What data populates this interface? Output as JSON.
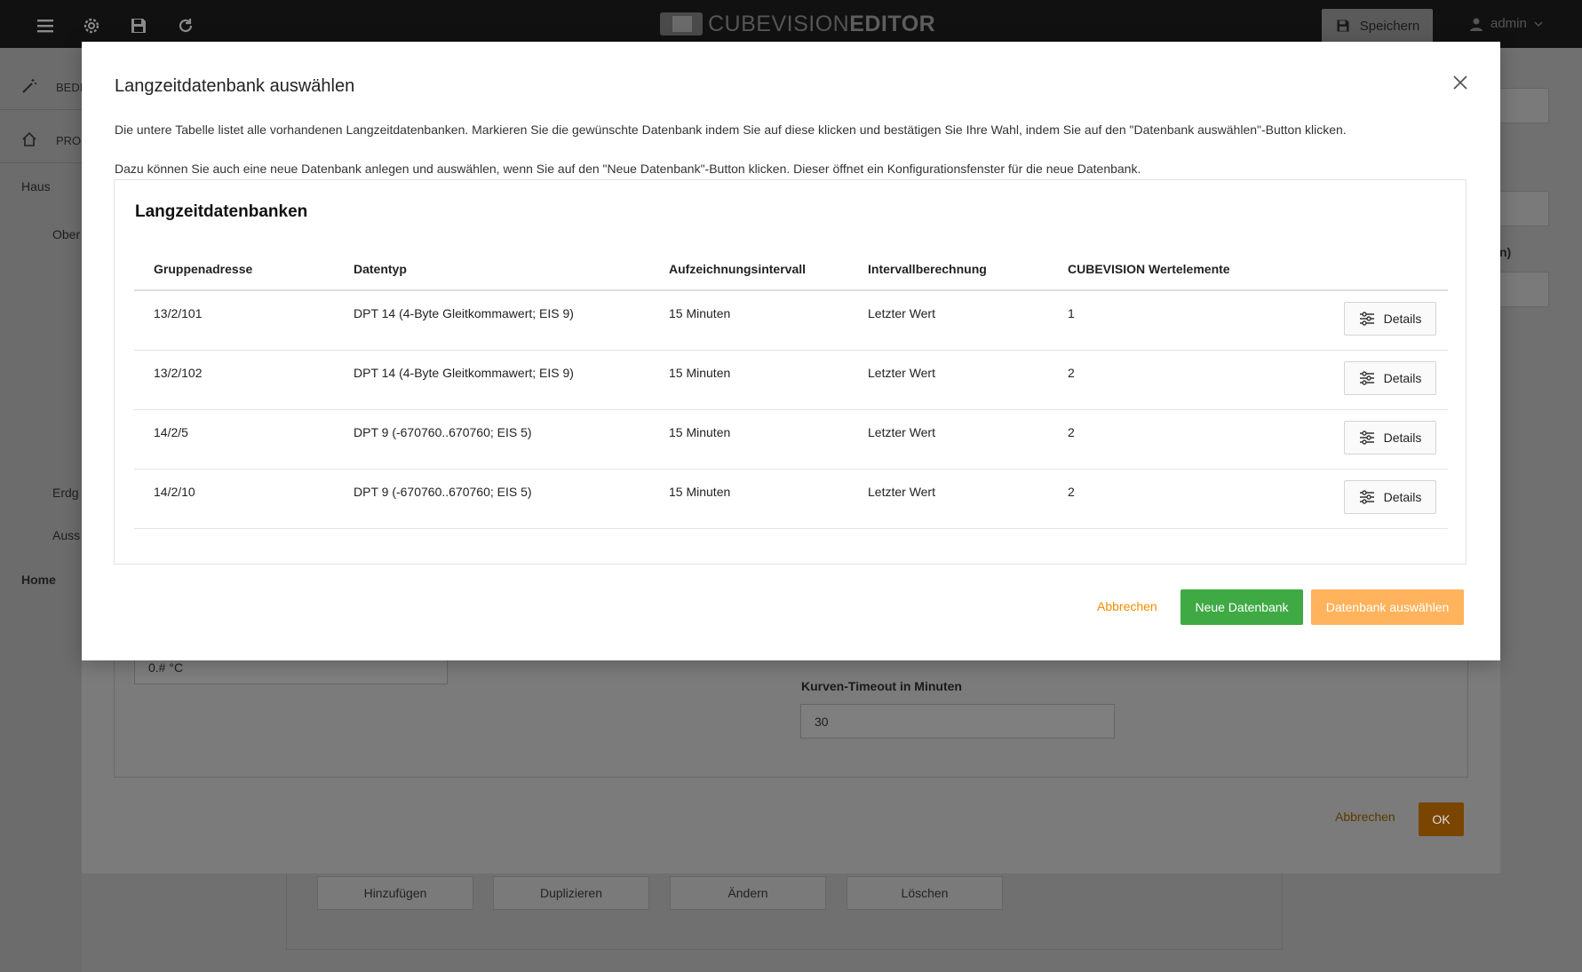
{
  "app": {
    "logo_light": "CUBEVISION",
    "logo_bold": "EDITOR",
    "save_label": "Speichern",
    "user_name": "admin"
  },
  "background": {
    "sidebar": [
      "BEDI",
      "PRO",
      "Haus",
      "Ober",
      "Erdg",
      "Auss",
      "Home"
    ],
    "right_fragment": "n)",
    "format_value": "0.# °C",
    "timeout_label": "Kurven-Timeout in Minuten",
    "timeout_value": "30",
    "cancel_label": "Abbrechen",
    "ok_label": "OK",
    "buttons": [
      "Hinzufügen",
      "Duplizieren",
      "Ändern",
      "Löschen"
    ]
  },
  "modal": {
    "title": "Langzeitdatenbank auswählen",
    "desc1": "Die untere Tabelle listet alle vorhandenen Langzeitdatenbanken. Markieren Sie die gewünschte Datenbank indem Sie auf diese klicken und bestätigen Sie Ihre Wahl, indem Sie auf den \"Datenbank auswählen\"-Button klicken.",
    "desc2": "Dazu können Sie auch eine neue Datenbank anlegen und auswählen, wenn Sie auf den \"Neue Datenbank\"-Button klicken. Dieser öffnet ein Konfigurationsfenster für die neue Datenbank.",
    "card_title": "Langzeitdatenbanken",
    "columns": [
      "Gruppenadresse",
      "Datentyp",
      "Aufzeichnungsintervall",
      "Intervallberechnung",
      "CUBEVISION Wertelemente"
    ],
    "rows": [
      {
        "address": "13/2/101",
        "type": "DPT 14 (4-Byte Gleitkommawert; EIS 9)",
        "interval": "15 Minuten",
        "calc": "Letzter Wert",
        "elements": "1",
        "details": "Details"
      },
      {
        "address": "13/2/102",
        "type": "DPT 14 (4-Byte Gleitkommawert; EIS 9)",
        "interval": "15 Minuten",
        "calc": "Letzter Wert",
        "elements": "2",
        "details": "Details"
      },
      {
        "address": "14/2/5",
        "type": "DPT 9 (-670760..670760; EIS 5)",
        "interval": "15 Minuten",
        "calc": "Letzter Wert",
        "elements": "2",
        "details": "Details"
      },
      {
        "address": "14/2/10",
        "type": "DPT 9 (-670760..670760; EIS 5)",
        "interval": "15 Minuten",
        "calc": "Letzter Wert",
        "elements": "2",
        "details": "Details"
      }
    ],
    "cancel_label": "Abbrechen",
    "new_label": "Neue Datenbank",
    "select_label": "Datenbank auswählen"
  },
  "colors": {
    "accent_orange": "#f28c00",
    "select_disabled": "#ffb35c",
    "green": "#3fa944"
  }
}
